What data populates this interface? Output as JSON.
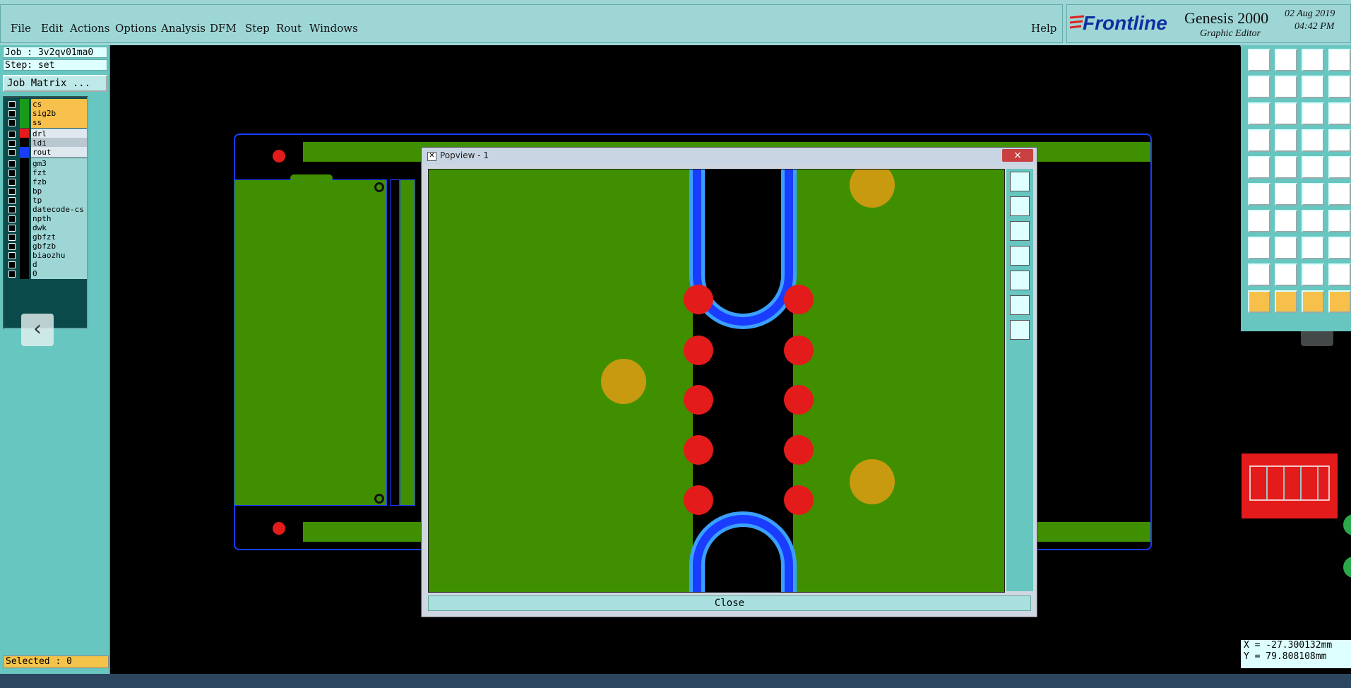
{
  "menu": {
    "items": [
      "File",
      "Edit",
      "Actions",
      "Options",
      "Analysis",
      "DFM",
      "Step",
      "Rout",
      "Windows"
    ],
    "help": "Help"
  },
  "brand": {
    "logo": "Frontline",
    "product": "Genesis 2000",
    "subtitle": "Graphic Editor",
    "date": "02 Aug 2019",
    "time": "04:42 PM"
  },
  "job": {
    "job_label": "Job : 3v2qv01ma0",
    "step_label": "Step: set",
    "matrix_button": "Job Matrix ..."
  },
  "layers": [
    {
      "name": "cs",
      "color": "#1a9a1a",
      "bg": "#f7c04a"
    },
    {
      "name": "sig2b",
      "color": "#1a9a1a",
      "bg": "#f7c04a"
    },
    {
      "name": "ss",
      "color": "#1a9a1a",
      "bg": "#f7c04a"
    },
    {
      "name": "drl",
      "color": "#e41b1b",
      "bg": "#dfe8ef"
    },
    {
      "name": "ldi",
      "color": "#000000",
      "bg": "#b9c7d0"
    },
    {
      "name": "rout",
      "color": "#1a3cff",
      "bg": "#dfe8ef"
    },
    {
      "name": "gm3",
      "color": "#000000",
      "bg": "#9ed6d6"
    },
    {
      "name": "fzt",
      "color": "#000000",
      "bg": "#9ed6d6"
    },
    {
      "name": "fzb",
      "color": "#000000",
      "bg": "#9ed6d6"
    },
    {
      "name": "bp",
      "color": "#000000",
      "bg": "#9ed6d6"
    },
    {
      "name": "tp",
      "color": "#000000",
      "bg": "#9ed6d6"
    },
    {
      "name": "datecode-cs",
      "color": "#000000",
      "bg": "#9ed6d6"
    },
    {
      "name": "npth",
      "color": "#000000",
      "bg": "#9ed6d6"
    },
    {
      "name": "dwk",
      "color": "#000000",
      "bg": "#9ed6d6"
    },
    {
      "name": "gbfzt",
      "color": "#000000",
      "bg": "#9ed6d6"
    },
    {
      "name": "gbfzb",
      "color": "#000000",
      "bg": "#9ed6d6"
    },
    {
      "name": "biaozhu",
      "color": "#000000",
      "bg": "#9ed6d6"
    },
    {
      "name": "d",
      "color": "#000000",
      "bg": "#9ed6d6"
    },
    {
      "name": "0",
      "color": "#000000",
      "bg": "#9ed6d6"
    }
  ],
  "status": {
    "selected": "Selected : 0",
    "x_coord": "X = -27.300132mm",
    "y_coord": "Y = 79.808108mm"
  },
  "popview": {
    "title": "Popview - 1",
    "close_button": "Close",
    "close_x": "×"
  },
  "colors": {
    "panel": "#67c6c0",
    "copper": "#3f8f00",
    "rout": "#1a3cff",
    "drill": "#e41b1b",
    "pad": "#c79a10"
  }
}
